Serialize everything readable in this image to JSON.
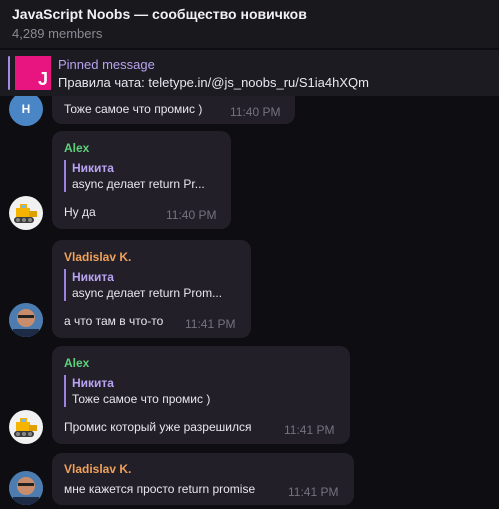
{
  "header": {
    "title": "JavaScript Noobs — сообщество новичков",
    "members": "4,289 members"
  },
  "pinned": {
    "title": "Pinned message",
    "text": "Правила чата: teletype.in/@js_noobs_ru/S1ia4hXQm",
    "thumb_letter": "J",
    "thumb_color": "#e8147f"
  },
  "messages": [
    {
      "avatar_letter": "H",
      "text": "Тоже самое что промис )",
      "time": "11:40 PM"
    },
    {
      "sender": "Alex",
      "sender_color": "#5ed07a",
      "quote_name": "Никита",
      "quote_text": "async делает return Pr...",
      "text": "Ну да",
      "time": "11:40 PM"
    },
    {
      "sender": "Vladislav K.",
      "sender_color": "#f0a15a",
      "quote_name": "Никита",
      "quote_text": "async делает return Prom...",
      "text": "а что там в что-то",
      "time": "11:41 PM"
    },
    {
      "sender": "Alex",
      "sender_color": "#5ed07a",
      "quote_name": "Никита",
      "quote_text": "Тоже самое что промис )",
      "text": "Промис который уже разрешился",
      "time": "11:41 PM"
    },
    {
      "sender": "Vladislav K.",
      "sender_color": "#f0a15a",
      "text": "мне кажется просто return promise",
      "time": "11:41 PM"
    }
  ]
}
